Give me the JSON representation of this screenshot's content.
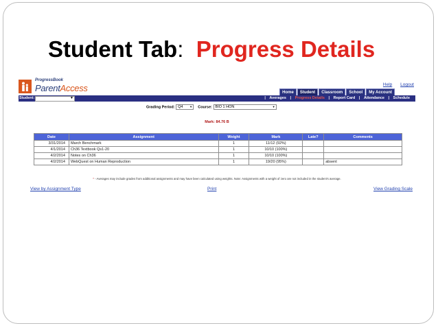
{
  "slide": {
    "title_part1": "Student Tab",
    "title_colon": ":",
    "title_part2": "Progress Details"
  },
  "app": {
    "logo_small": "ProgressBook",
    "logo_parent": "Parent",
    "logo_access": "Access",
    "top_links": {
      "help": "Help",
      "logout": "Logout"
    },
    "tabs": [
      "Home",
      "Student",
      "Classroom",
      "School",
      "My Account"
    ],
    "active_tab": "Student",
    "student_label": "Student:",
    "subnav": [
      "Averages",
      "Progress Details",
      "Report Card",
      "Attendance",
      "Schedule"
    ],
    "active_subnav": "Progress Details",
    "filters": {
      "grading_period_label": "Grading Period:",
      "grading_period_value": "Q4",
      "course_label": "Course:",
      "course_value": "BIO 1 HON"
    },
    "mark": "Mark: 84.76 B",
    "table": {
      "headers": [
        "Date",
        "Assignment",
        "Weight",
        "Mark",
        "Late?",
        "Comments"
      ],
      "rows": [
        [
          "3/31/2014",
          "March Benchmark",
          "1",
          "11/12 (92%)",
          "",
          ""
        ],
        [
          "4/1/2014",
          "Ch36 Textbook Qs1-20",
          "1",
          "10/10 (100%)",
          "",
          ""
        ],
        [
          "4/2/2014",
          "Notes on Ch36",
          "1",
          "10/10 (100%)",
          "",
          ""
        ],
        [
          "4/2/2014",
          "WebQuest on Human Reproduction",
          "1",
          "19/20 (95%)",
          "",
          "absent"
        ]
      ]
    },
    "footnote_star": "*",
    "footnote": " - Averages may include grades from additional assignments and may have been calculated using weights. Note: Assignments with a weight of zero are not included in the student's average.",
    "bottom_links": {
      "view_by_type": "View by Assignment Type",
      "print": "Print",
      "grading_scale": "View Grading Scale"
    },
    "colors": {
      "navbar": "#2a2f82",
      "table_header": "#4d64d8",
      "accent_red": "#e0261f",
      "logo_orange": "#d9571e"
    }
  }
}
